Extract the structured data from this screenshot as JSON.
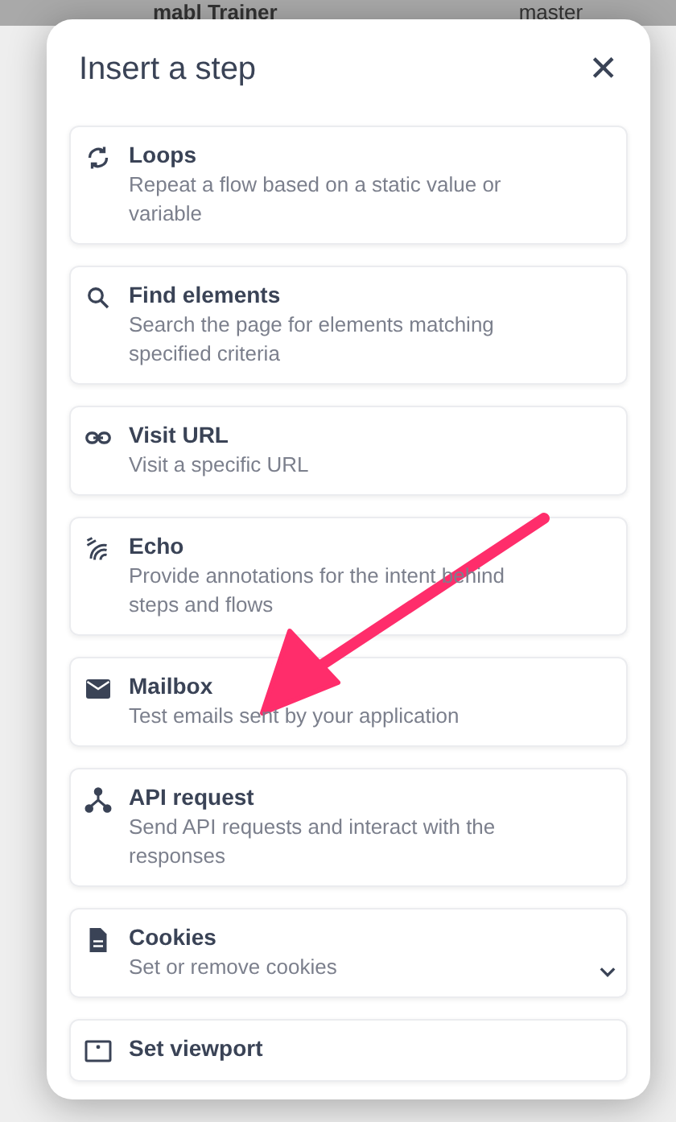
{
  "background_header": {
    "app_name": "mabl Trainer",
    "branch": "master"
  },
  "dialog": {
    "title": "Insert a step",
    "close": "✕"
  },
  "steps": [
    {
      "name": "Loops",
      "description": "Repeat a flow based on a static value or variable",
      "kind": "plain"
    },
    {
      "name": "Find elements",
      "description": "Search the page for elements matching specified criteria",
      "kind": "plain"
    },
    {
      "name": "Visit URL",
      "description": "Visit a specific URL",
      "kind": "plain"
    },
    {
      "name": "Echo",
      "description": "Provide annotations for the intent behind steps and flows",
      "kind": "plain"
    },
    {
      "name": "Mailbox",
      "description": "Test emails sent by your application",
      "kind": "plain"
    },
    {
      "name": "API request",
      "description": "Send API requests and interact with the responses",
      "kind": "plain"
    },
    {
      "name": "Cookies",
      "description": "Set or remove cookies",
      "kind": "expandable"
    },
    {
      "name": "Set viewport",
      "kind": "plain"
    }
  ]
}
